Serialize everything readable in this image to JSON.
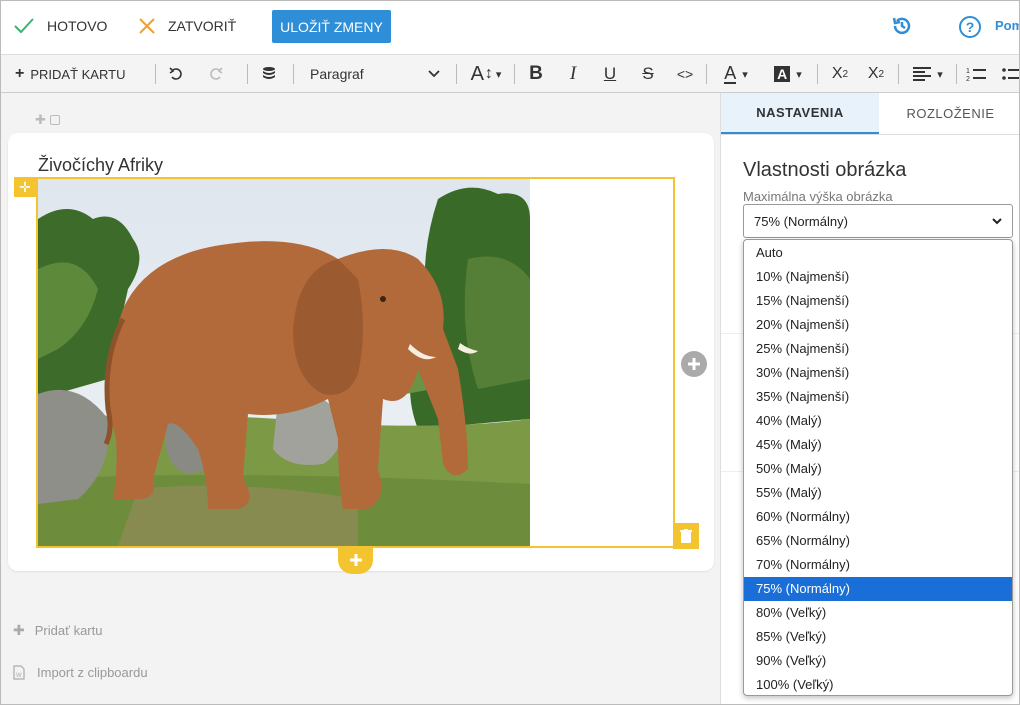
{
  "topbar": {
    "done_label": "HOTOVO",
    "close_label": "ZATVORIŤ",
    "save_label": "ULOŽIŤ ZMENY",
    "help_label": "Pom"
  },
  "toolbar": {
    "add_card_label": "PRIDAŤ KARTU",
    "paragraph_select": "Paragraf"
  },
  "editor": {
    "card_title": "Živočíchy Afriky",
    "add_card_link": "Pridať kartu",
    "import_link": "Import z clipboardu"
  },
  "right_panel": {
    "tabs": [
      {
        "label": "NASTAVENIA",
        "active": true
      },
      {
        "label": "ROZLOŽENIE",
        "active": false
      }
    ],
    "title": "Vlastnosti obrázka",
    "field_label": "Maximálna výška obrázka",
    "selected_value": "75% (Normálny)"
  },
  "dropdown": {
    "options": [
      "Auto",
      "10% (Najmenší)",
      "15% (Najmenší)",
      "20% (Najmenší)",
      "25% (Najmenší)",
      "30% (Najmenší)",
      "35% (Najmenší)",
      "40% (Malý)",
      "45% (Malý)",
      "50% (Malý)",
      "55% (Malý)",
      "60% (Normálny)",
      "65% (Normálny)",
      "70% (Normálny)",
      "75% (Normálny)",
      "80% (Veľký)",
      "85% (Veľký)",
      "90% (Veľký)",
      "100% (Veľký)"
    ],
    "selected_index": 14
  },
  "colors": {
    "accent": "#2e8ed8",
    "selection": "#1a6ed8",
    "highlight": "#f4c430",
    "done_check": "#3cb371",
    "close_x": "#f0a030"
  }
}
